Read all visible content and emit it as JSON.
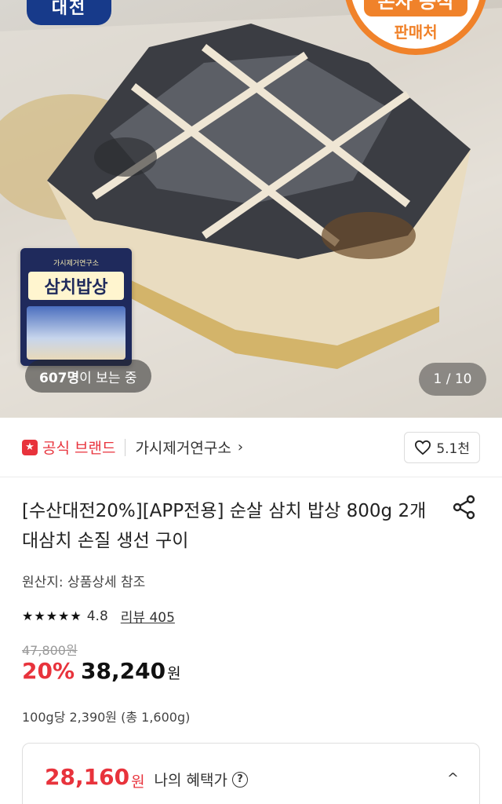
{
  "hero": {
    "brand_logo_text": "대전",
    "official_badge_top": "본사 공식",
    "official_badge_bottom": "판매처",
    "package_subtitle": "가시제거연구소",
    "package_title": "삼치밥상",
    "viewers_count": "607명",
    "viewers_suffix": "이 보는 중",
    "page_counter": "1 / 10"
  },
  "brand_row": {
    "official_label": "공식 브랜드",
    "seller_name": "가시제거연구소",
    "like_count": "5.1천"
  },
  "product": {
    "title": "[수산대전20%][APP전용] 순살 삼치 밥상 800g 2개 대삼치 손질 생선 구이",
    "origin": "원산지: 상품상세 참조",
    "rating": "4.8",
    "review_label": "리뷰 405",
    "original_price": "47,800원",
    "discount_rate": "20%",
    "sale_price": "38,240",
    "currency": "원",
    "unit_price": "100g당 2,390원 (총 1,600g)"
  },
  "benefit": {
    "price": "28,160",
    "currency": "원",
    "label": "나의 혜택가"
  },
  "colors": {
    "accent_red": "#e8333c",
    "badge_orange": "#f0822a",
    "logo_blue": "#173a8a"
  },
  "icons": [
    "heart-icon",
    "share-icon",
    "star-icon",
    "help-icon",
    "chevron-right-icon",
    "chevron-up-icon"
  ]
}
